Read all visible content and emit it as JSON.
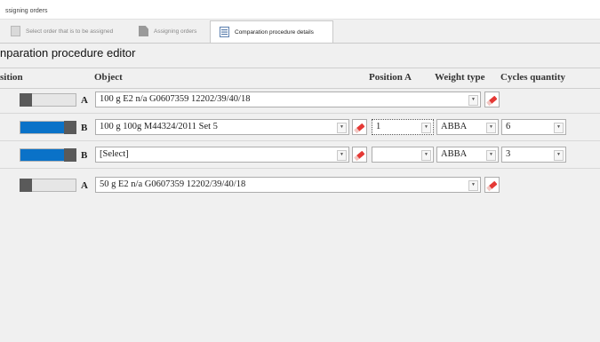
{
  "window": {
    "title": "ssigning orders"
  },
  "tabs": [
    {
      "label": "Select order that is to be assigned"
    },
    {
      "label": "Assigning orders"
    },
    {
      "label": "Comparation procedure details",
      "active": true
    }
  ],
  "page_title": "nparation procedure editor",
  "columns": {
    "position": "sition",
    "object": "Object",
    "position_a": "Position A",
    "weight_type": "Weight type",
    "cycles_quantity": "Cycles quantity"
  },
  "rows": [
    {
      "state": "off",
      "letter": "A",
      "object": "100 g E2 n/a G0607359 12202/39/40/18"
    },
    {
      "state": "on",
      "letter": "B",
      "object": "100 g 100g M44324/2011 Set 5",
      "position_a": "1",
      "weight_type": "ABBA",
      "cycles": "6"
    },
    {
      "state": "on",
      "letter": "B",
      "object": "[Select]",
      "position_a": "",
      "weight_type": "ABBA",
      "cycles": "3"
    },
    {
      "state": "off",
      "letter": "A",
      "object": "50 g E2 n/a G0607359 12202/39/40/18"
    }
  ],
  "icons": {
    "dropdown": "chevron-down-icon",
    "eraser": "eraser-icon",
    "tab1": "document-icon",
    "tab2": "box-icon",
    "tab3": "form-icon"
  },
  "colors": {
    "toggle_on": "#0a72c8",
    "knob": "#5a5a5a",
    "eraser": "#e53935"
  }
}
